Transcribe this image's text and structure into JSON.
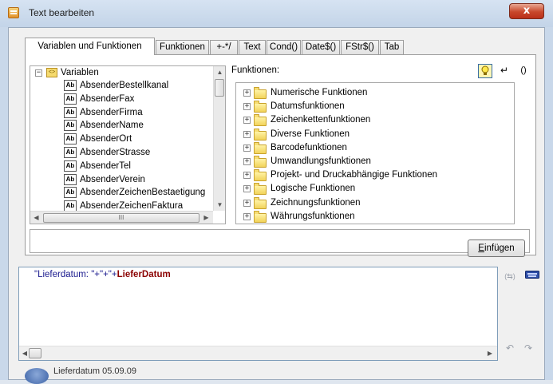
{
  "window": {
    "title": "Text bearbeiten",
    "close_label": "x"
  },
  "tabs": [
    {
      "label": "Variablen und Funktionen",
      "active": true
    },
    {
      "label": "Funktionen",
      "active": false
    },
    {
      "label": "+-*/",
      "active": false
    },
    {
      "label": "Text",
      "active": false
    },
    {
      "label": "Cond()",
      "active": false
    },
    {
      "label": "Date$()",
      "active": false
    },
    {
      "label": "FStr$()",
      "active": false
    },
    {
      "label": "Tab",
      "active": false
    }
  ],
  "variables_tree": {
    "root_label": "Variablen",
    "root_icon_label": "<>",
    "item_icon_label": "Ab",
    "items": [
      "AbsenderBestellkanal",
      "AbsenderFax",
      "AbsenderFirma",
      "AbsenderName",
      "AbsenderOrt",
      "AbsenderStrasse",
      "AbsenderTel",
      "AbsenderVerein",
      "AbsenderZeichenBestaetigung",
      "AbsenderZeichenFaktura"
    ],
    "hscroll_thumb_label": "III"
  },
  "functions": {
    "label": "Funktionen:",
    "items": [
      "Numerische Funktionen",
      "Datumsfunktionen",
      "Zeichenkettenfunktionen",
      "Diverse Funktionen",
      "Barcodefunktionen",
      "Umwandlungsfunktionen",
      "Projekt- und Druckabhängige Funktionen",
      "Logische Funktionen",
      "Zeichnungsfunktionen",
      "Währungsfunktionen"
    ],
    "toolbar": {
      "enter_glyph": "↵",
      "braces_glyph": "()"
    }
  },
  "insert_button": {
    "mnemonic": "E",
    "rest": "infügen"
  },
  "editor": {
    "formula_string": "\"Lieferdatum: \"+\"+\"+",
    "formula_variable": "LieferDatum"
  },
  "status": {
    "text": "Lieferdatum  05.09.09"
  },
  "colors": {
    "accent": "#3c62a6",
    "title_bg": "#c9d8ea",
    "close": "#c8472b"
  }
}
